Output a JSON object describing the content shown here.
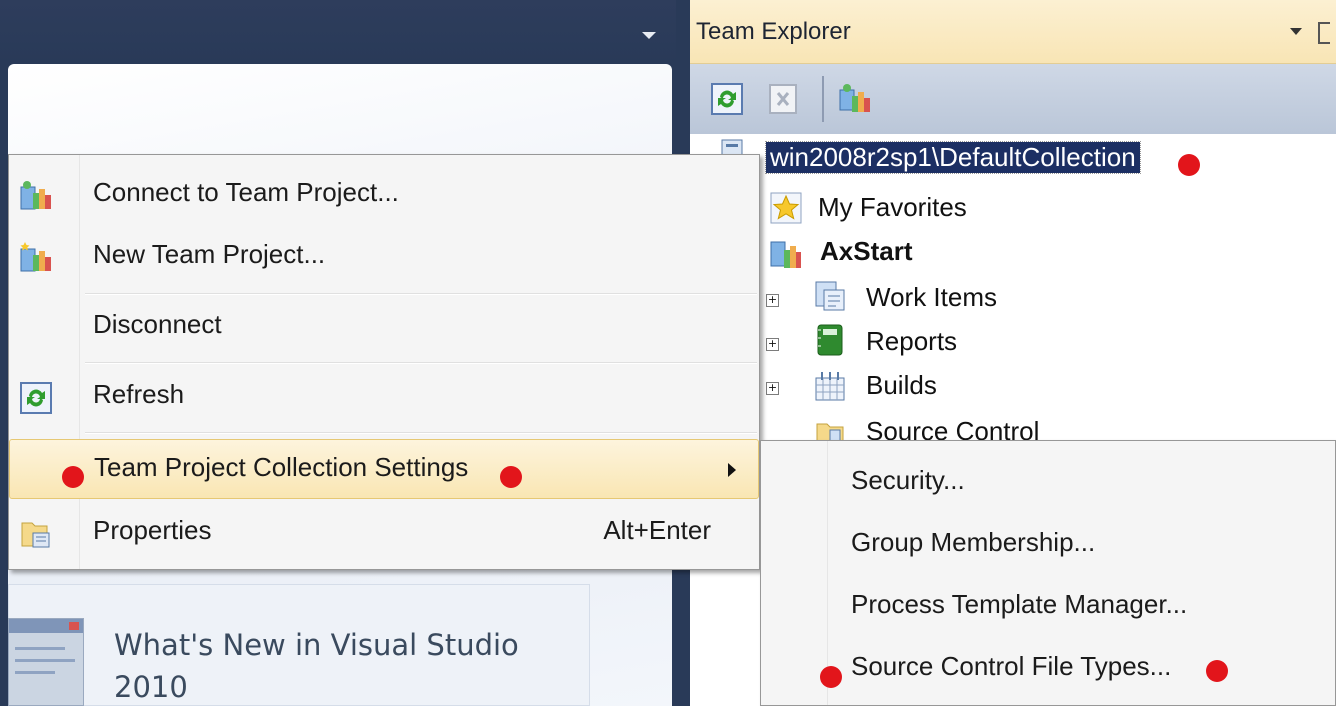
{
  "team_explorer": {
    "title": "Team Explorer",
    "toolbar": {
      "refresh_icon": "refresh-icon",
      "stop_icon": "stop-icon",
      "connect_icon": "connect-team-project-icon"
    },
    "tree": {
      "collection": "win2008r2sp1\\DefaultCollection",
      "favorites": "My Favorites",
      "project": "AxStart",
      "children": [
        {
          "label": "Work Items",
          "icon": "work-items-icon",
          "expandable": true
        },
        {
          "label": "Reports",
          "icon": "reports-icon",
          "expandable": true
        },
        {
          "label": "Builds",
          "icon": "builds-icon",
          "expandable": true
        },
        {
          "label": "Source Control",
          "icon": "source-control-icon",
          "expandable": false
        }
      ]
    }
  },
  "context_menu": {
    "items": [
      {
        "label": "Connect to Team Project...",
        "icon": "connect-team-project-icon"
      },
      {
        "label": "New Team Project...",
        "icon": "new-team-project-icon"
      },
      {
        "label": "Disconnect",
        "icon": ""
      },
      {
        "label": "Refresh",
        "icon": "refresh-icon"
      },
      {
        "label": "Team Project Collection Settings",
        "icon": "",
        "has_submenu": true,
        "highlighted": true
      },
      {
        "label": "Properties",
        "icon": "properties-icon",
        "shortcut": "Alt+Enter"
      }
    ]
  },
  "submenu": {
    "items": [
      {
        "label": "Security..."
      },
      {
        "label": "Group Membership..."
      },
      {
        "label": "Process Template Manager..."
      },
      {
        "label": "Source Control File Types..."
      }
    ]
  },
  "start_page": {
    "card_title_line1": "What's New in Visual Studio",
    "card_title_line2": "2010"
  },
  "colors": {
    "annotation_dot": "#e2151b",
    "selection": "#1c2f63",
    "highlight": "#f9e6b3",
    "header_bar": "#293a58"
  }
}
